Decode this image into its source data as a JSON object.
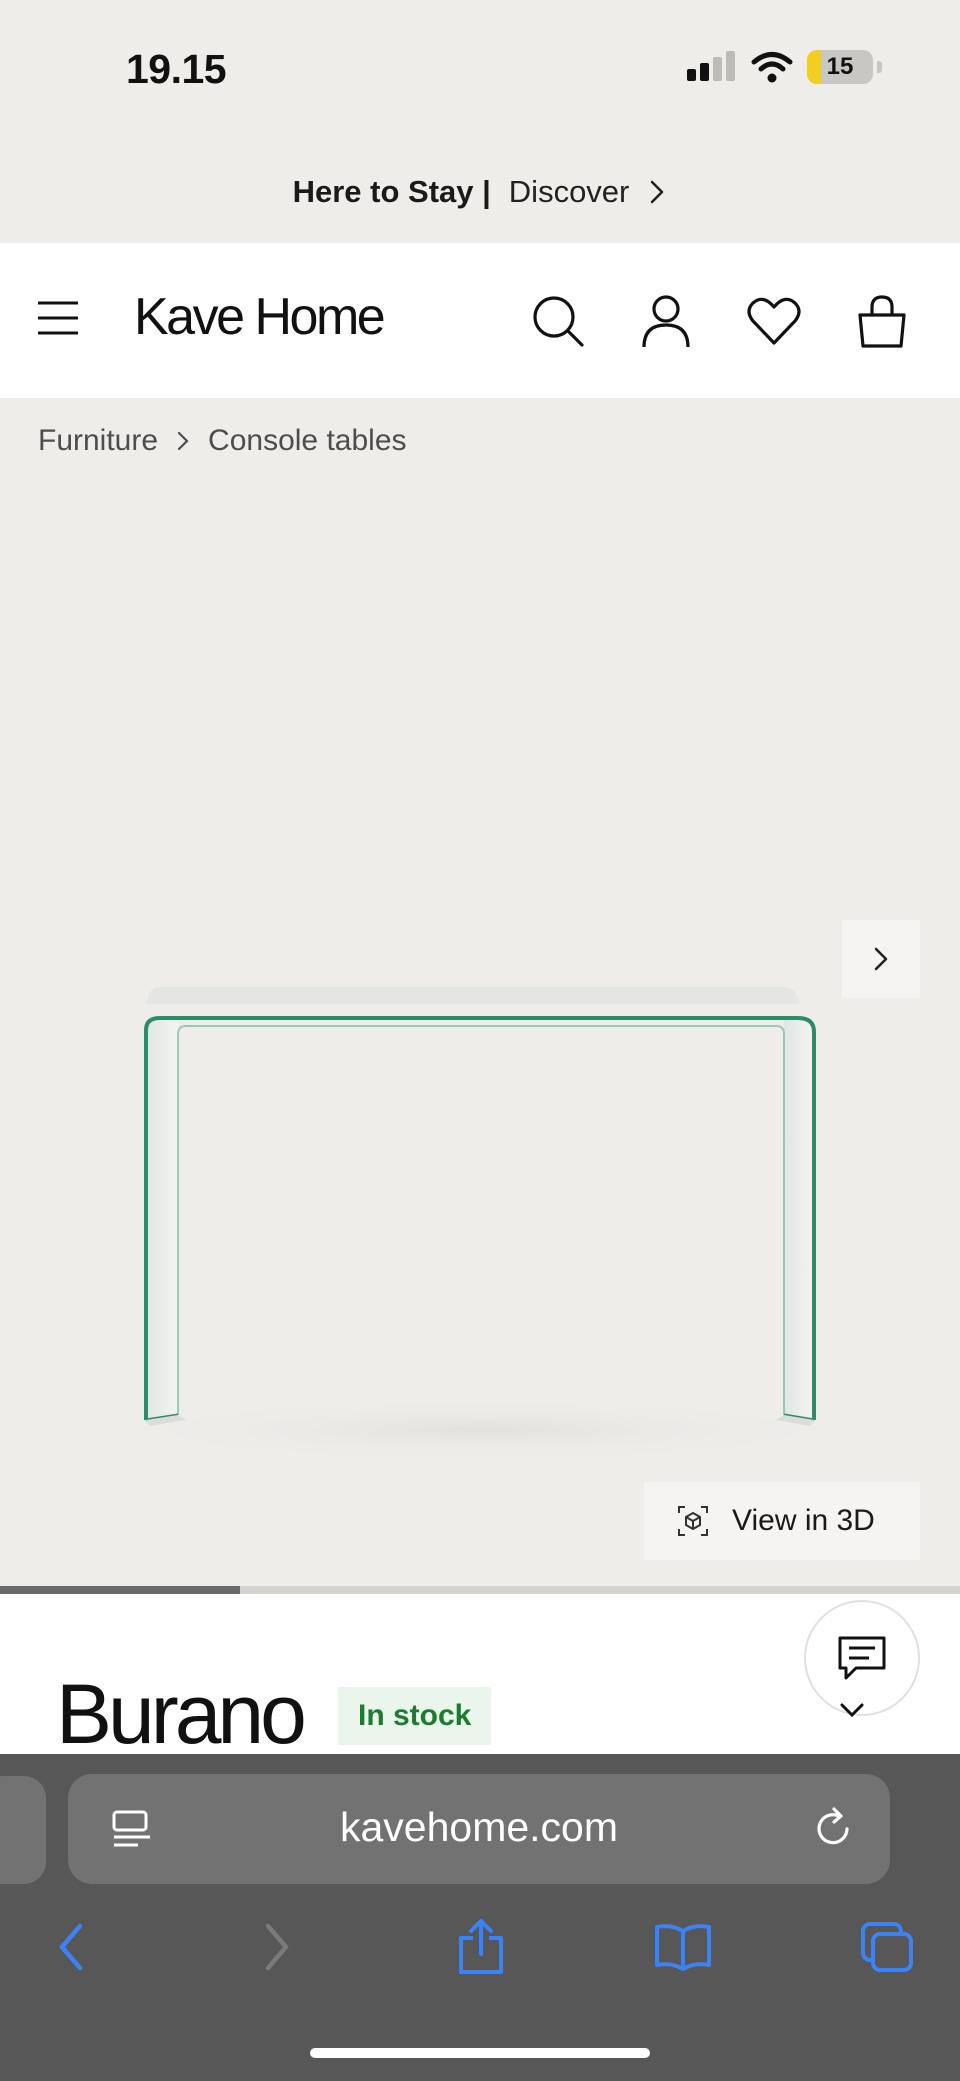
{
  "status_bar": {
    "time": "19.15",
    "battery": "15"
  },
  "promo": {
    "highlight": "Here to Stay |",
    "link": "Discover"
  },
  "header": {
    "logo": "Kave Home"
  },
  "breadcrumb": {
    "items": [
      "Furniture",
      "Console tables"
    ]
  },
  "gallery": {
    "view3d_label": "View in 3D",
    "progress": 0.25
  },
  "product": {
    "name": "Burano",
    "stock": "In stock"
  },
  "browser": {
    "url": "kavehome.com"
  },
  "colors": {
    "accent_blue": "#3b82f6",
    "stock_green": "#1f7a32",
    "glass_edge": "#2e8b6a"
  }
}
